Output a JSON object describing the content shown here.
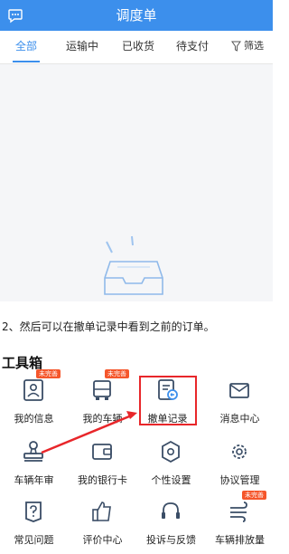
{
  "header": {
    "title": "调度单"
  },
  "tabs": [
    {
      "label": "全部"
    },
    {
      "label": "运输中"
    },
    {
      "label": "已收货"
    },
    {
      "label": "待支付"
    }
  ],
  "filter_label": "筛选",
  "caption": "2、然后可以在撤单记录中看到之前的订单。",
  "toolbox": {
    "title": "工具箱",
    "items": [
      {
        "label": "我的信息",
        "icon": "id-card-icon",
        "badge": "未完善"
      },
      {
        "label": "我的车辆",
        "icon": "bus-icon",
        "badge": "未完善"
      },
      {
        "label": "撤单记录",
        "icon": "cancel-record-icon"
      },
      {
        "label": "消息中心",
        "icon": "mail-icon"
      },
      {
        "label": "车辆年审",
        "icon": "stamp-icon"
      },
      {
        "label": "我的银行卡",
        "icon": "wallet-icon"
      },
      {
        "label": "个性设置",
        "icon": "hexagon-settings-icon"
      },
      {
        "label": "协议管理",
        "icon": "gear-icon"
      },
      {
        "label": "常见问题",
        "icon": "help-doc-icon"
      },
      {
        "label": "评价中心",
        "icon": "thumbs-up-icon"
      },
      {
        "label": "投诉与反馈",
        "icon": "headset-icon"
      },
      {
        "label": "车辆排放量",
        "icon": "wind-icon",
        "badge": "未完善"
      }
    ]
  },
  "colors": {
    "brand": "#3c8fec",
    "icon": "#3a4d66",
    "badge": "#f5562b",
    "highlight": "#e8262a"
  }
}
